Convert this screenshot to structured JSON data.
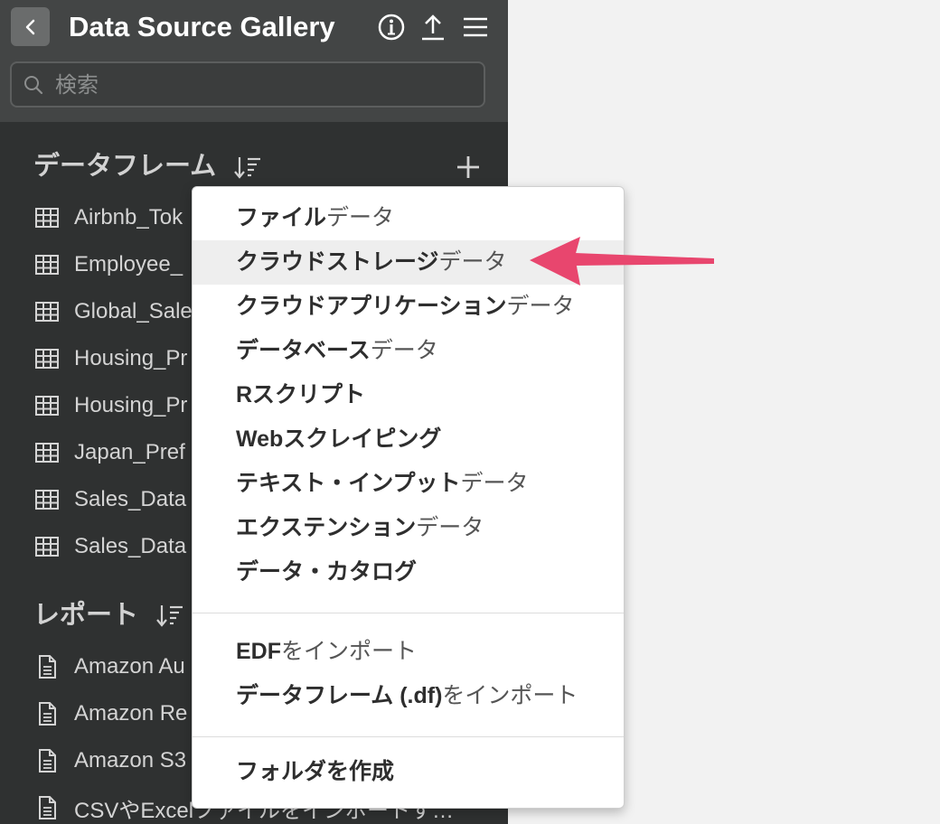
{
  "header": {
    "title": "Data Source Gallery",
    "back_icon": "chevron-left-icon",
    "info_icon": "info-icon",
    "upload_icon": "upload-icon",
    "menu_icon": "hamburger-icon"
  },
  "search": {
    "placeholder": "検索",
    "value": ""
  },
  "dataframes": {
    "title": "データフレーム",
    "items": [
      "Airbnb_Tok",
      "Employee_",
      "Global_Sale",
      "Housing_Pr",
      "Housing_Pr",
      "Japan_Pref",
      "Sales_Data",
      "Sales_Data"
    ]
  },
  "reports": {
    "title": "レポート",
    "items": [
      "Amazon Au",
      "Amazon Re",
      "Amazon S3",
      "CSVやExcelファイルをインポートす…"
    ]
  },
  "menu": {
    "group1": [
      {
        "bold": "ファイル",
        "normal": "データ"
      },
      {
        "bold": "クラウドストレージ",
        "normal": "データ"
      },
      {
        "bold": "クラウドアプリケーション",
        "normal": "データ"
      },
      {
        "bold": "データベース",
        "normal": "データ"
      },
      {
        "bold": "Rスクリプト",
        "normal": ""
      },
      {
        "bold": "Webスクレイピング",
        "normal": ""
      },
      {
        "bold": "テキスト・インプット",
        "normal": "データ"
      },
      {
        "bold": "エクステンション",
        "normal": "データ"
      },
      {
        "bold": "データ・カタログ",
        "normal": ""
      }
    ],
    "group2": [
      {
        "bold": "EDF",
        "normal": "をインポート"
      },
      {
        "bold": "データフレーム (.df)",
        "normal": "をインポート"
      }
    ],
    "group3": [
      {
        "bold": "フォルダを作成",
        "normal": ""
      }
    ]
  },
  "colors": {
    "sidebar_bg": "#2f3131",
    "topbar_bg": "#434545",
    "arrow": "#e8466e",
    "menu_highlight": "#eeeeee"
  }
}
